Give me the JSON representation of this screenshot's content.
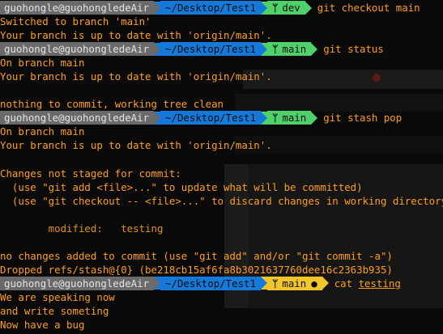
{
  "prompt": {
    "user": "guohongle@guohongledeAir",
    "path": "~/Desktop/Test1"
  },
  "lines": [
    {
      "type": "prompt",
      "branch": "dev",
      "dirty": false,
      "command": "git checkout main"
    },
    {
      "type": "text",
      "text": "Switched to branch 'main'"
    },
    {
      "type": "text",
      "text": "Your branch is up to date with 'origin/main'."
    },
    {
      "type": "prompt",
      "branch": "main",
      "dirty": false,
      "command": "git status"
    },
    {
      "type": "text",
      "text": "On branch main"
    },
    {
      "type": "text",
      "text": "Your branch is up to date with 'origin/main'."
    },
    {
      "type": "blank"
    },
    {
      "type": "text",
      "text": "nothing to commit, working tree clean"
    },
    {
      "type": "prompt",
      "branch": "main",
      "dirty": false,
      "command": "git stash pop"
    },
    {
      "type": "text",
      "text": "On branch main"
    },
    {
      "type": "text",
      "text": "Your branch is up to date with 'origin/main'."
    },
    {
      "type": "blank"
    },
    {
      "type": "text",
      "text": "Changes not staged for commit:"
    },
    {
      "type": "text",
      "text": "  (use \"git add <file>...\" to update what will be committed)"
    },
    {
      "type": "text",
      "text": "  (use \"git checkout -- <file>...\" to discard changes in working directory)"
    },
    {
      "type": "blank"
    },
    {
      "type": "text",
      "text": "        modified:   testing",
      "style": "modified"
    },
    {
      "type": "blank"
    },
    {
      "type": "text",
      "text": "no changes added to commit (use \"git add\" and/or \"git commit -a\")"
    },
    {
      "type": "text",
      "text": "Dropped refs/stash@{0} (be218cb15af6fa8b3021637760dee16c2363b935)"
    },
    {
      "type": "prompt",
      "branch": "main",
      "dirty": true,
      "status": "●",
      "command": "cat",
      "arg": "testing"
    },
    {
      "type": "text",
      "text": "We are speaking now"
    },
    {
      "type": "text",
      "text": "and write someting"
    },
    {
      "type": "text",
      "text": "Now have a bug"
    }
  ],
  "colors": {
    "output": "#ff9f1a",
    "user_segment": "#6a6a6a",
    "path_segment": "#1479d9",
    "git_clean": "#4ed06a",
    "git_dirty": "#f2c52a",
    "background": "#0a0a0a"
  },
  "icons": {
    "branch": "git-branch-icon"
  }
}
